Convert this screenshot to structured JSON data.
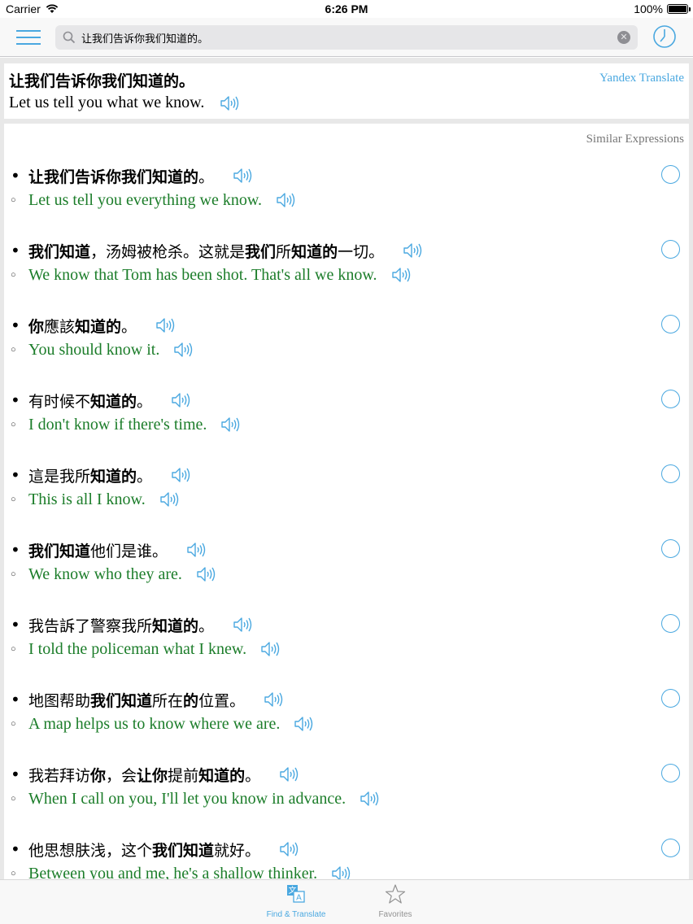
{
  "status_bar": {
    "carrier": "Carrier",
    "time": "6:26 PM",
    "battery": "100%",
    "battery_level": 1.0
  },
  "search": {
    "value": "让我们告诉你我们知道的。",
    "placeholder": ""
  },
  "translation": {
    "source": "让我们告诉你我们知道的。",
    "result": "Let us tell you what we know.",
    "provider": "Yandex Translate"
  },
  "similar": {
    "header": "Similar Expressions",
    "items": [
      {
        "zh": [
          {
            "t": "让我们告诉你我们知道的",
            "b": true
          },
          {
            "t": "。",
            "b": false
          }
        ],
        "en": "Let us tell you everything we know."
      },
      {
        "zh": [
          {
            "t": "我们知道",
            "b": true
          },
          {
            "t": "，汤姆被枪杀。这就是",
            "b": false
          },
          {
            "t": "我们",
            "b": true
          },
          {
            "t": "所",
            "b": false
          },
          {
            "t": "知道的",
            "b": true
          },
          {
            "t": "一切。",
            "b": false
          }
        ],
        "en": "We know that Tom has been shot. That's all we know."
      },
      {
        "zh": [
          {
            "t": "你",
            "b": true
          },
          {
            "t": "應該",
            "b": false
          },
          {
            "t": "知道的",
            "b": true
          },
          {
            "t": "。",
            "b": false
          }
        ],
        "en": "You should know it."
      },
      {
        "zh": [
          {
            "t": "有时候不",
            "b": false
          },
          {
            "t": "知道的",
            "b": true
          },
          {
            "t": "。",
            "b": false
          }
        ],
        "en": "I don't know if there's time."
      },
      {
        "zh": [
          {
            "t": "這是我所",
            "b": false
          },
          {
            "t": "知道的",
            "b": true
          },
          {
            "t": "。",
            "b": false
          }
        ],
        "en": "This is all I know."
      },
      {
        "zh": [
          {
            "t": "我们知道",
            "b": true
          },
          {
            "t": "他们是谁。",
            "b": false
          }
        ],
        "en": "We know who they are."
      },
      {
        "zh": [
          {
            "t": "我告訴了警察我所",
            "b": false
          },
          {
            "t": "知道的",
            "b": true
          },
          {
            "t": "。",
            "b": false
          }
        ],
        "en": "I told the policeman what I knew."
      },
      {
        "zh": [
          {
            "t": "地图帮助",
            "b": false
          },
          {
            "t": "我们知道",
            "b": true
          },
          {
            "t": "所在",
            "b": false
          },
          {
            "t": "的",
            "b": true
          },
          {
            "t": "位置。",
            "b": false
          }
        ],
        "en": "A map helps us to know where we are."
      },
      {
        "zh": [
          {
            "t": "我若拜访",
            "b": false
          },
          {
            "t": "你",
            "b": true
          },
          {
            "t": "，会",
            "b": false
          },
          {
            "t": "让你",
            "b": true
          },
          {
            "t": "提前",
            "b": false
          },
          {
            "t": "知道的",
            "b": true
          },
          {
            "t": "。",
            "b": false
          }
        ],
        "en": "When I call on you, I'll let you know in advance."
      },
      {
        "zh": [
          {
            "t": "他思想肤浅，这个",
            "b": false
          },
          {
            "t": "我们知道",
            "b": true
          },
          {
            "t": "就好。",
            "b": false
          }
        ],
        "en": "Between you and me, he's a shallow thinker."
      }
    ]
  },
  "tabs": [
    {
      "label": "Find & Translate",
      "active": true,
      "icon": "translate-icon"
    },
    {
      "label": "Favorites",
      "active": false,
      "icon": "star-icon"
    }
  ],
  "colors": {
    "accent": "#4aa8e0",
    "english": "#1c7d2a"
  }
}
